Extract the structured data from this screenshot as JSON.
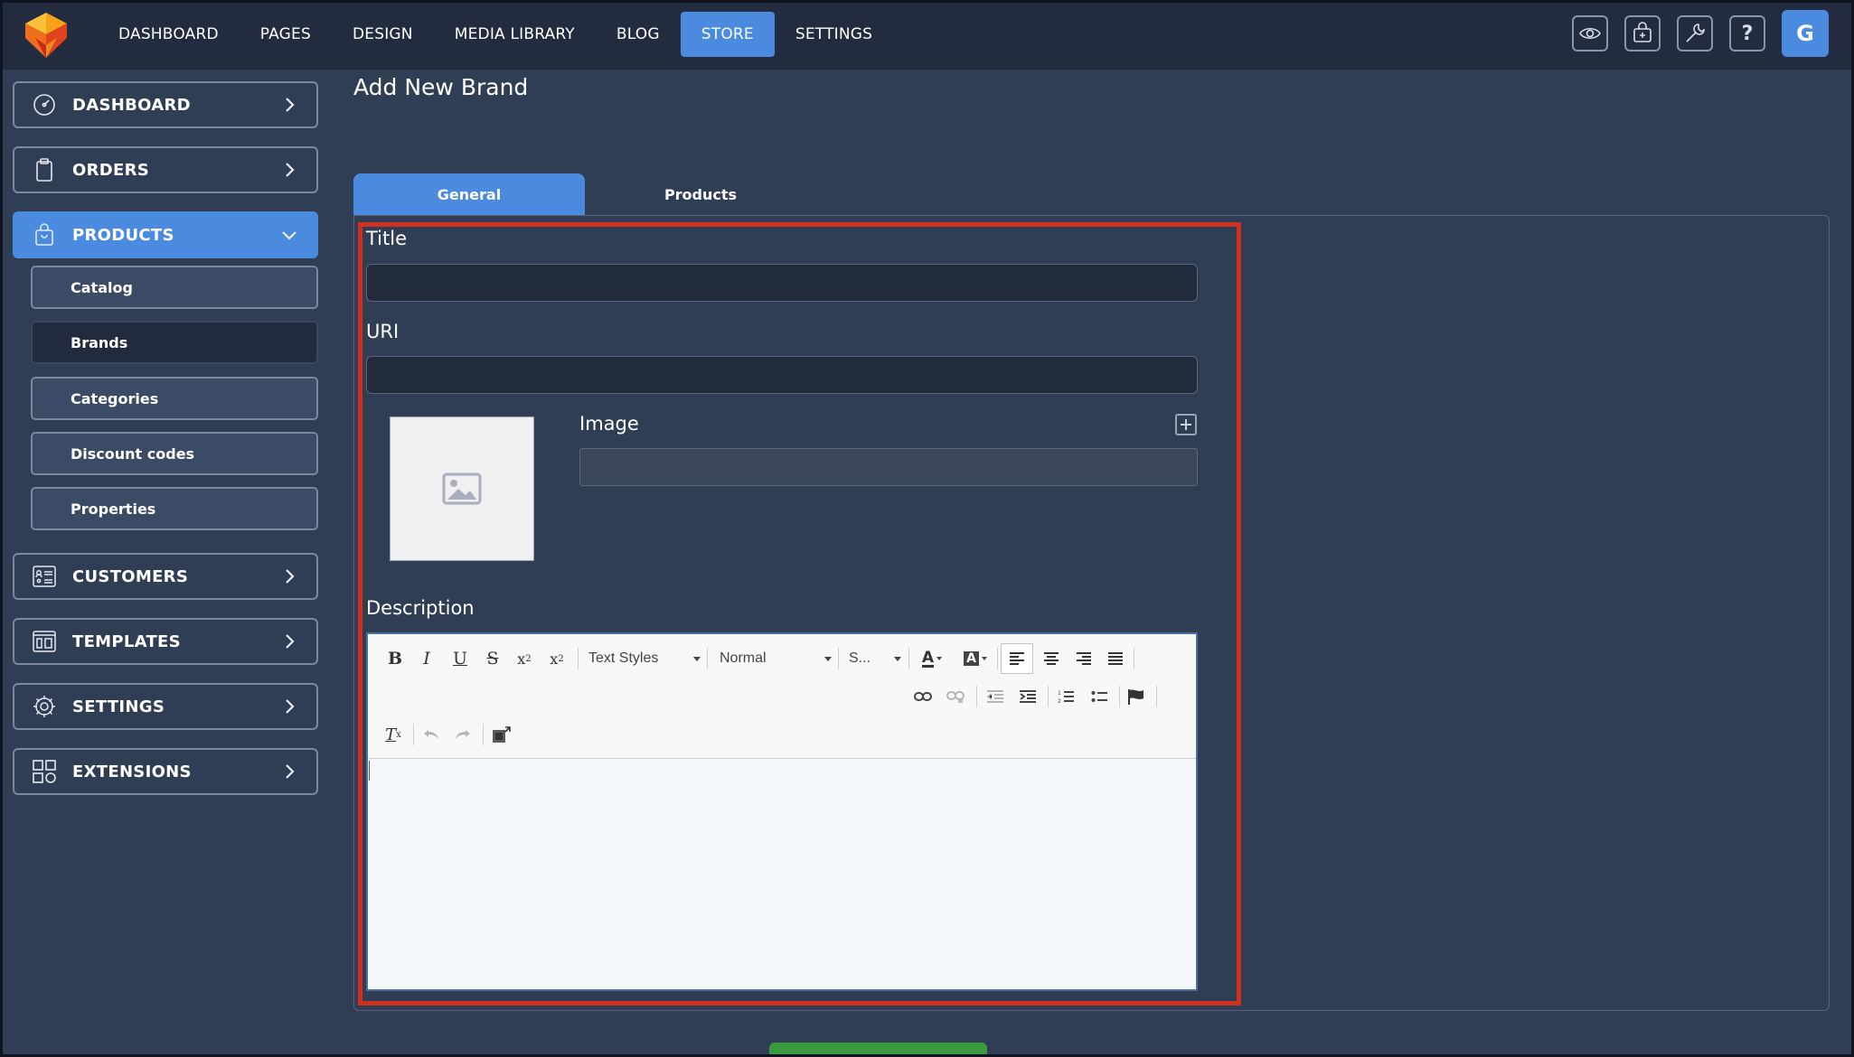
{
  "topnav": {
    "items": [
      "DASHBOARD",
      "PAGES",
      "DESIGN",
      "MEDIA LIBRARY",
      "BLOG",
      "STORE",
      "SETTINGS"
    ],
    "active": "STORE",
    "avatar_letter": "G",
    "icons": [
      "eye-icon",
      "store-icon",
      "wrench-icon",
      "help-icon"
    ]
  },
  "sidebar": {
    "items": [
      {
        "label": "DASHBOARD",
        "icon": "speedometer-icon"
      },
      {
        "label": "ORDERS",
        "icon": "clipboard-icon"
      },
      {
        "label": "PRODUCTS",
        "icon": "shopping-bag-icon"
      },
      {
        "label": "CUSTOMERS",
        "icon": "contacts-icon"
      },
      {
        "label": "TEMPLATES",
        "icon": "layout-icon"
      },
      {
        "label": "SETTINGS",
        "icon": "gear-icon"
      },
      {
        "label": "EXTENSIONS",
        "icon": "grid-icon"
      }
    ],
    "products_sub": [
      "Catalog",
      "Brands",
      "Categories",
      "Discount codes",
      "Properties"
    ],
    "selected_sub": "Brands"
  },
  "page": {
    "title": "Add New Brand",
    "tabs": [
      "General",
      "Products"
    ],
    "active_tab": "General"
  },
  "form": {
    "title_label": "Title",
    "title_value": "",
    "uri_label": "URI",
    "uri_value": "",
    "image_label": "Image",
    "image_value": "",
    "description_label": "Description"
  },
  "editor": {
    "text_styles": "Text Styles",
    "format": "Normal",
    "size": "S...",
    "content": ""
  },
  "colors": {
    "accent": "#4a8be0",
    "highlight": "#d0311f",
    "background": "#2f3d55",
    "topbar": "#222c3e",
    "save": "#3a9a3d"
  }
}
